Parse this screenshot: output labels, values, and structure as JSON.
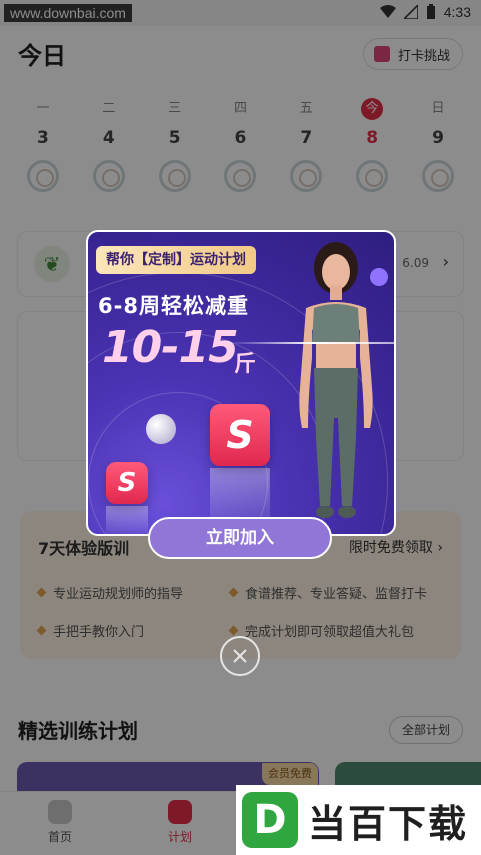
{
  "status_bar": {
    "watermark_url": "www.downbai.com",
    "time": "4:33"
  },
  "header": {
    "title": "今日",
    "checkin_label": "打卡挑战"
  },
  "week": [
    {
      "label": "一",
      "num": "3",
      "today": false
    },
    {
      "label": "二",
      "num": "4",
      "today": false
    },
    {
      "label": "三",
      "num": "5",
      "today": false
    },
    {
      "label": "四",
      "num": "6",
      "today": false
    },
    {
      "label": "五",
      "num": "7",
      "today": false
    },
    {
      "label": "今",
      "num": "8",
      "today": true
    },
    {
      "label": "日",
      "num": "9",
      "today": false
    }
  ],
  "food_card": {
    "value": "6.09"
  },
  "trial": {
    "title": "7天体验版训",
    "free_label": "限时免费领取",
    "items": [
      "专业运动规划师的指导",
      "食谱推荐、专业答疑、监督打卡",
      "手把手教你入门",
      "完成计划即可领取超值大礼包"
    ]
  },
  "plans_section": {
    "title": "精选训练计划",
    "all_label": "全部计划",
    "vip_badge": "会员免费"
  },
  "nav": {
    "home": "首页",
    "plan": "计划"
  },
  "modal": {
    "tag": "帮你【定制】运动计划",
    "headline": "6-8周轻松减重",
    "big_number": "10-15",
    "unit": "斤",
    "logo_letter": "S",
    "cta": "立即加入"
  },
  "brand": {
    "mark": "D",
    "text": "当百下载"
  },
  "colors": {
    "accent_red": "#e5304a",
    "modal_purple": "#3a2696",
    "cta_purple": "#9076d6",
    "brand_green": "#2fa640"
  }
}
